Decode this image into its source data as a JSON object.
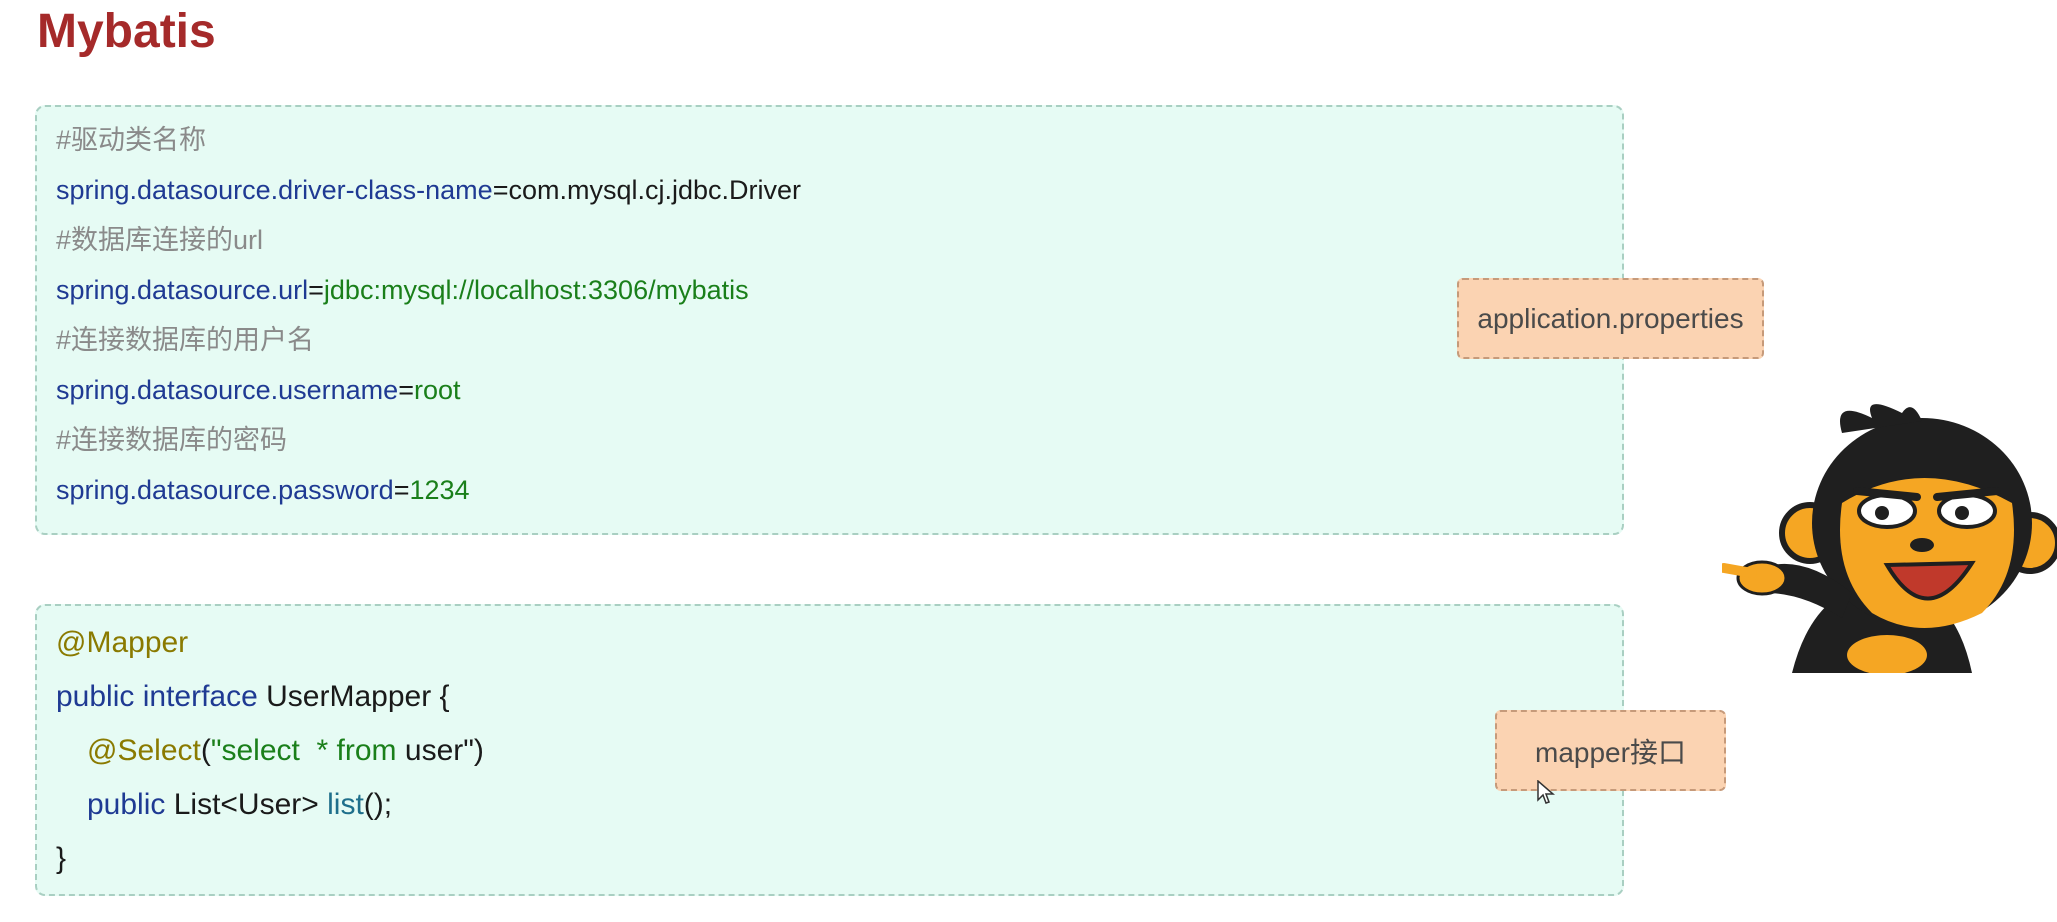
{
  "page": {
    "title": "Mybatis"
  },
  "properties_block": {
    "lines": [
      {
        "type": "comment",
        "text": "#驱动类名称"
      },
      {
        "type": "kv",
        "key": "spring.datasource.driver-class-name",
        "eq": "=",
        "value": "com.mysql.cj.jdbc.Driver"
      },
      {
        "type": "comment",
        "text": "#数据库连接的url"
      },
      {
        "type": "kv",
        "key": "spring.datasource.url",
        "eq": "=",
        "value": "jdbc:mysql://localhost:3306/mybatis"
      },
      {
        "type": "comment",
        "text": "#连接数据库的用户名"
      },
      {
        "type": "kv",
        "key": "spring.datasource.username",
        "eq": "=",
        "value": "root"
      },
      {
        "type": "comment",
        "text": "#连接数据库的密码"
      },
      {
        "type": "kv",
        "key": "spring.datasource.password",
        "eq": "=",
        "value": "1234"
      }
    ]
  },
  "mapper_block": {
    "annotation": "@Mapper",
    "line2_kw": "public interface",
    "line2_name": " UserMapper {",
    "select_anno": "@Select",
    "select_open": "(",
    "select_str": "\"select  * from",
    "select_str_tail": " user\"",
    "select_close": ")",
    "line4_kw": "public",
    "line4_type": " List<User> ",
    "line4_method": "list",
    "line4_tail": "();",
    "close_brace": "}"
  },
  "tags": {
    "properties_label": "application.properties",
    "mapper_label": "mapper接口"
  },
  "colors": {
    "title": "#a52a2a",
    "code_bg": "#e6fbf4",
    "tag_bg": "#fbd3b2",
    "key": "#1f3a93",
    "value": "#1a7f1a",
    "comment": "#8a8a8a",
    "annotation": "#8a7a00"
  },
  "icons": {
    "cursor": "mouse-pointer-icon",
    "mascot": "pointing-monkey-illustration"
  }
}
